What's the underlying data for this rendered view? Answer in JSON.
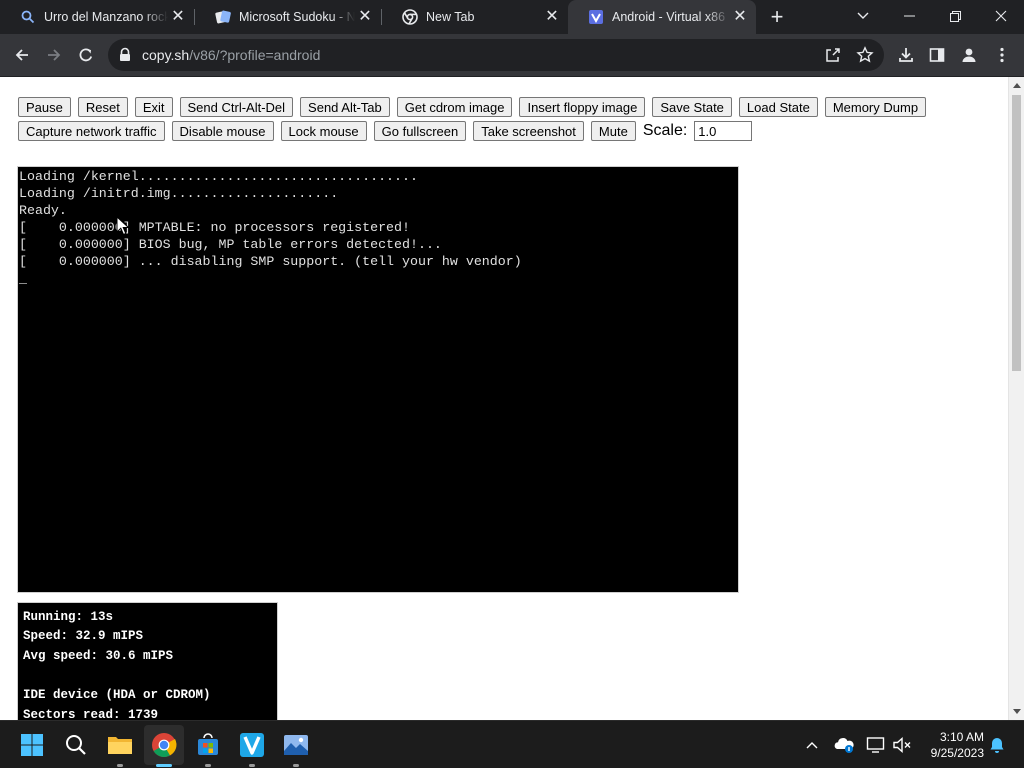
{
  "window": {
    "tabs": [
      {
        "title": "Urro del Manzano rocky",
        "favicon": "search-icon",
        "active": false
      },
      {
        "title": "Microsoft Sudoku - News",
        "favicon": "sudoku-icon",
        "active": false
      },
      {
        "title": "New Tab",
        "favicon": "chrome-icon",
        "active": false
      },
      {
        "title": "Android - Virtual x86",
        "favicon": "v86-icon",
        "active": true
      }
    ],
    "close_glyph": "✕",
    "new_tab_glyph": "+"
  },
  "toolbar": {
    "url_host": "copy.sh",
    "url_path": "/v86/?profile=android"
  },
  "controls": {
    "row1": [
      "Pause",
      "Reset",
      "Exit",
      "Send Ctrl-Alt-Del",
      "Send Alt-Tab",
      "Get cdrom image",
      "Insert floppy image",
      "Save State",
      "Load State",
      "Memory Dump"
    ],
    "row2": [
      "Capture network traffic",
      "Disable mouse",
      "Lock mouse",
      "Go fullscreen",
      "Take screenshot",
      "Mute"
    ],
    "scale_label": "Scale:",
    "scale_value": "1.0"
  },
  "screen": {
    "lines": [
      "Loading /kernel...................................",
      "Loading /initrd.img.....................",
      "Ready.",
      "[    0.000000] MPTABLE: no processors registered!",
      "[    0.000000] BIOS bug, MP table errors detected!...",
      "[    0.000000] ... disabling SMP support. (tell your hw vendor)",
      "_"
    ]
  },
  "info": {
    "running": "Running: 13s",
    "speed": "Speed: 32.9 mIPS",
    "avg_speed": "Avg speed: 30.6 mIPS",
    "ide_heading": "IDE device (HDA or CDROM)",
    "sectors_read": "Sectors read: 1739"
  },
  "taskbar": {
    "time": "3:10 AM",
    "date": "9/25/2023",
    "apps": [
      "start-icon",
      "search-icon",
      "file-explorer-icon",
      "chrome-icon",
      "store-icon",
      "vscode-like-v-icon",
      "photos-icon"
    ]
  },
  "colors": {
    "chrome_dark": "#202124",
    "toolbar": "#35363a",
    "terminal_bg": "#000000",
    "terminal_fg": "#e0e0e0",
    "taskbar": "#1c1c1c"
  }
}
